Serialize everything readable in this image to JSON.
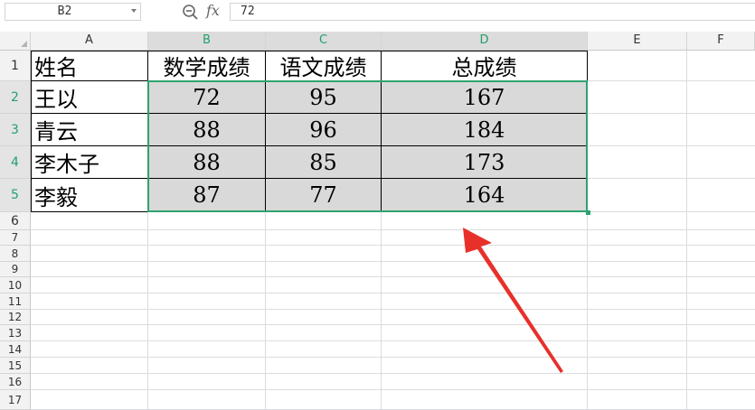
{
  "formula_bar": {
    "name_box": "B2",
    "formula": "72"
  },
  "columns": [
    "A",
    "B",
    "C",
    "D",
    "E",
    "F"
  ],
  "rows": [
    "1",
    "2",
    "3",
    "4",
    "5",
    "6",
    "7",
    "8",
    "9",
    "10",
    "11",
    "12",
    "13",
    "14",
    "15",
    "16",
    "17"
  ],
  "table": {
    "headers": [
      "姓名",
      "数学成绩",
      "语文成绩",
      "总成绩"
    ],
    "data": [
      [
        "王以",
        "72",
        "95",
        "167"
      ],
      [
        "青云",
        "88",
        "96",
        "184"
      ],
      [
        "李木子",
        "88",
        "85",
        "173"
      ],
      [
        "李毅",
        "87",
        "77",
        "164"
      ]
    ]
  },
  "selection": "B2:D5",
  "colors": {
    "selection": "#2ea36f",
    "fill": "#d9d9d9",
    "arrow": "#e8302a"
  }
}
